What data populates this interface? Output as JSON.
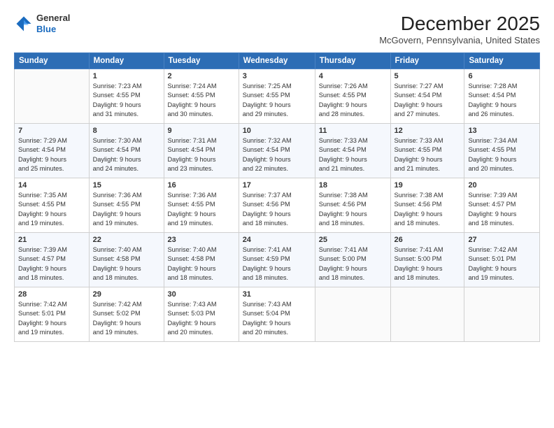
{
  "logo": {
    "general": "General",
    "blue": "Blue"
  },
  "title": "December 2025",
  "location": "McGovern, Pennsylvania, United States",
  "days_header": [
    "Sunday",
    "Monday",
    "Tuesday",
    "Wednesday",
    "Thursday",
    "Friday",
    "Saturday"
  ],
  "weeks": [
    [
      {
        "day": "",
        "content": ""
      },
      {
        "day": "1",
        "content": "Sunrise: 7:23 AM\nSunset: 4:55 PM\nDaylight: 9 hours\nand 31 minutes."
      },
      {
        "day": "2",
        "content": "Sunrise: 7:24 AM\nSunset: 4:55 PM\nDaylight: 9 hours\nand 30 minutes."
      },
      {
        "day": "3",
        "content": "Sunrise: 7:25 AM\nSunset: 4:55 PM\nDaylight: 9 hours\nand 29 minutes."
      },
      {
        "day": "4",
        "content": "Sunrise: 7:26 AM\nSunset: 4:55 PM\nDaylight: 9 hours\nand 28 minutes."
      },
      {
        "day": "5",
        "content": "Sunrise: 7:27 AM\nSunset: 4:54 PM\nDaylight: 9 hours\nand 27 minutes."
      },
      {
        "day": "6",
        "content": "Sunrise: 7:28 AM\nSunset: 4:54 PM\nDaylight: 9 hours\nand 26 minutes."
      }
    ],
    [
      {
        "day": "7",
        "content": "Sunrise: 7:29 AM\nSunset: 4:54 PM\nDaylight: 9 hours\nand 25 minutes."
      },
      {
        "day": "8",
        "content": "Sunrise: 7:30 AM\nSunset: 4:54 PM\nDaylight: 9 hours\nand 24 minutes."
      },
      {
        "day": "9",
        "content": "Sunrise: 7:31 AM\nSunset: 4:54 PM\nDaylight: 9 hours\nand 23 minutes."
      },
      {
        "day": "10",
        "content": "Sunrise: 7:32 AM\nSunset: 4:54 PM\nDaylight: 9 hours\nand 22 minutes."
      },
      {
        "day": "11",
        "content": "Sunrise: 7:33 AM\nSunset: 4:54 PM\nDaylight: 9 hours\nand 21 minutes."
      },
      {
        "day": "12",
        "content": "Sunrise: 7:33 AM\nSunset: 4:55 PM\nDaylight: 9 hours\nand 21 minutes."
      },
      {
        "day": "13",
        "content": "Sunrise: 7:34 AM\nSunset: 4:55 PM\nDaylight: 9 hours\nand 20 minutes."
      }
    ],
    [
      {
        "day": "14",
        "content": "Sunrise: 7:35 AM\nSunset: 4:55 PM\nDaylight: 9 hours\nand 19 minutes."
      },
      {
        "day": "15",
        "content": "Sunrise: 7:36 AM\nSunset: 4:55 PM\nDaylight: 9 hours\nand 19 minutes."
      },
      {
        "day": "16",
        "content": "Sunrise: 7:36 AM\nSunset: 4:55 PM\nDaylight: 9 hours\nand 19 minutes."
      },
      {
        "day": "17",
        "content": "Sunrise: 7:37 AM\nSunset: 4:56 PM\nDaylight: 9 hours\nand 18 minutes."
      },
      {
        "day": "18",
        "content": "Sunrise: 7:38 AM\nSunset: 4:56 PM\nDaylight: 9 hours\nand 18 minutes."
      },
      {
        "day": "19",
        "content": "Sunrise: 7:38 AM\nSunset: 4:56 PM\nDaylight: 9 hours\nand 18 minutes."
      },
      {
        "day": "20",
        "content": "Sunrise: 7:39 AM\nSunset: 4:57 PM\nDaylight: 9 hours\nand 18 minutes."
      }
    ],
    [
      {
        "day": "21",
        "content": "Sunrise: 7:39 AM\nSunset: 4:57 PM\nDaylight: 9 hours\nand 18 minutes."
      },
      {
        "day": "22",
        "content": "Sunrise: 7:40 AM\nSunset: 4:58 PM\nDaylight: 9 hours\nand 18 minutes."
      },
      {
        "day": "23",
        "content": "Sunrise: 7:40 AM\nSunset: 4:58 PM\nDaylight: 9 hours\nand 18 minutes."
      },
      {
        "day": "24",
        "content": "Sunrise: 7:41 AM\nSunset: 4:59 PM\nDaylight: 9 hours\nand 18 minutes."
      },
      {
        "day": "25",
        "content": "Sunrise: 7:41 AM\nSunset: 5:00 PM\nDaylight: 9 hours\nand 18 minutes."
      },
      {
        "day": "26",
        "content": "Sunrise: 7:41 AM\nSunset: 5:00 PM\nDaylight: 9 hours\nand 18 minutes."
      },
      {
        "day": "27",
        "content": "Sunrise: 7:42 AM\nSunset: 5:01 PM\nDaylight: 9 hours\nand 19 minutes."
      }
    ],
    [
      {
        "day": "28",
        "content": "Sunrise: 7:42 AM\nSunset: 5:01 PM\nDaylight: 9 hours\nand 19 minutes."
      },
      {
        "day": "29",
        "content": "Sunrise: 7:42 AM\nSunset: 5:02 PM\nDaylight: 9 hours\nand 19 minutes."
      },
      {
        "day": "30",
        "content": "Sunrise: 7:43 AM\nSunset: 5:03 PM\nDaylight: 9 hours\nand 20 minutes."
      },
      {
        "day": "31",
        "content": "Sunrise: 7:43 AM\nSunset: 5:04 PM\nDaylight: 9 hours\nand 20 minutes."
      },
      {
        "day": "",
        "content": ""
      },
      {
        "day": "",
        "content": ""
      },
      {
        "day": "",
        "content": ""
      }
    ]
  ]
}
